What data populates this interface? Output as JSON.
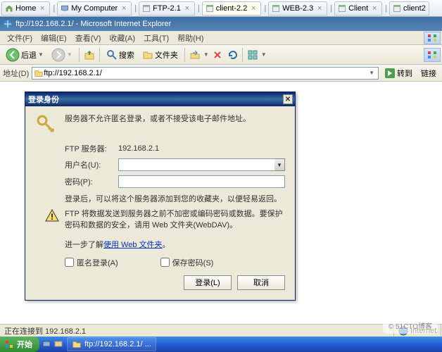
{
  "tabs": [
    {
      "label": "Home",
      "icon": "home"
    },
    {
      "label": "My Computer",
      "icon": "computer"
    },
    {
      "label": "FTP-2.1",
      "icon": "window"
    },
    {
      "label": "client-2.2",
      "icon": "window",
      "active": true
    },
    {
      "label": "WEB-2.3",
      "icon": "window"
    },
    {
      "label": "Client",
      "icon": "window"
    },
    {
      "label": "client2",
      "icon": "window"
    }
  ],
  "title": "ftp://192.168.2.1/ - Microsoft Internet Explorer",
  "menu": [
    "文件(F)",
    "编辑(E)",
    "查看(V)",
    "收藏(A)",
    "工具(T)",
    "帮助(H)"
  ],
  "toolbar": {
    "back": "后退",
    "search": "搜索",
    "folders": "文件夹"
  },
  "address": {
    "label": "地址(D)",
    "value": "ftp://192.168.2.1/",
    "go": "转到",
    "link": "链接"
  },
  "dialog": {
    "title": "登录身份",
    "message": "服务器不允许匿名登录，或者不接受该电子邮件地址。",
    "server_label": "FTP 服务器:",
    "server": "192.168.2.1",
    "user_label": "用户名(U):",
    "user": "",
    "pass_label": "密码(P):",
    "pass": "",
    "note": "登录后，可以将这个服务器添加到您的收藏夹，以便轻易返回。",
    "warn": "FTP 将数据发送到服务器之前不加密或编码密码或数据。要保护密码和数据的安全，请用 Web 文件夹(WebDAV)。",
    "link_pre": "进一步了解",
    "link": "使用 Web 文件夹",
    "link_post": "。",
    "anon": "匿名登录(A)",
    "save": "保存密码(S)",
    "login": "登录(L)",
    "cancel": "取消"
  },
  "status": {
    "connecting": "正在连接到 192.168.2.1",
    "zone": "Internet"
  },
  "taskbar": {
    "start": "开始",
    "task": "ftp://192.168.2.1/ ..."
  },
  "watermark": "© 51CTO博客"
}
